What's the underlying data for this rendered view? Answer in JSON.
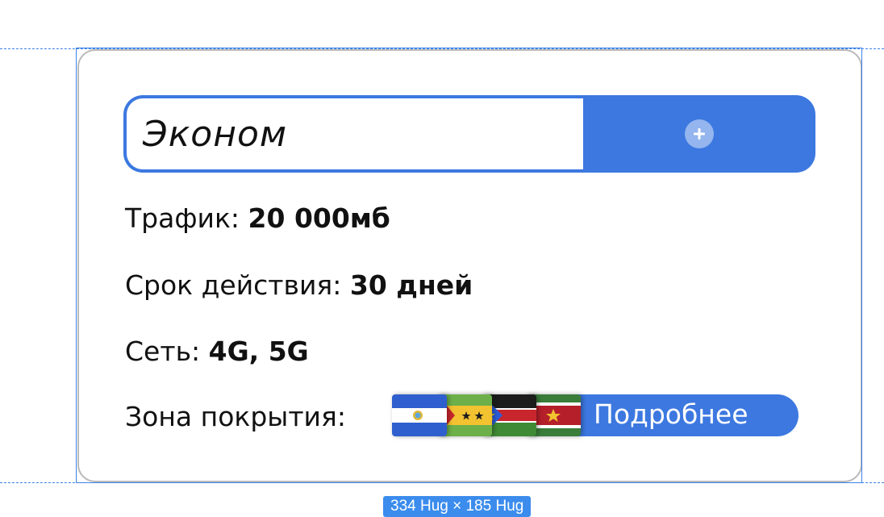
{
  "plan": {
    "name": "Эконом",
    "add_icon": "plus-icon"
  },
  "details": [
    {
      "label": "Трафик: ",
      "value": "20 000мб"
    },
    {
      "label": "Срок действия: ",
      "value": "30 дней"
    },
    {
      "label": "Сеть: ",
      "value": "4G, 5G"
    }
  ],
  "coverage": {
    "label": "Зона покрытия:",
    "flags": [
      "nicaragua-flag-icon",
      "sao-tome-flag-icon",
      "south-sudan-flag-icon",
      "suriname-flag-icon"
    ],
    "more_label": "Подробнее"
  },
  "selection": {
    "size_label": "334 Hug × 185 Hug"
  },
  "colors": {
    "accent": "#3c78e0",
    "selection": "#3b82e6",
    "card_border": "#b9b9b9"
  }
}
